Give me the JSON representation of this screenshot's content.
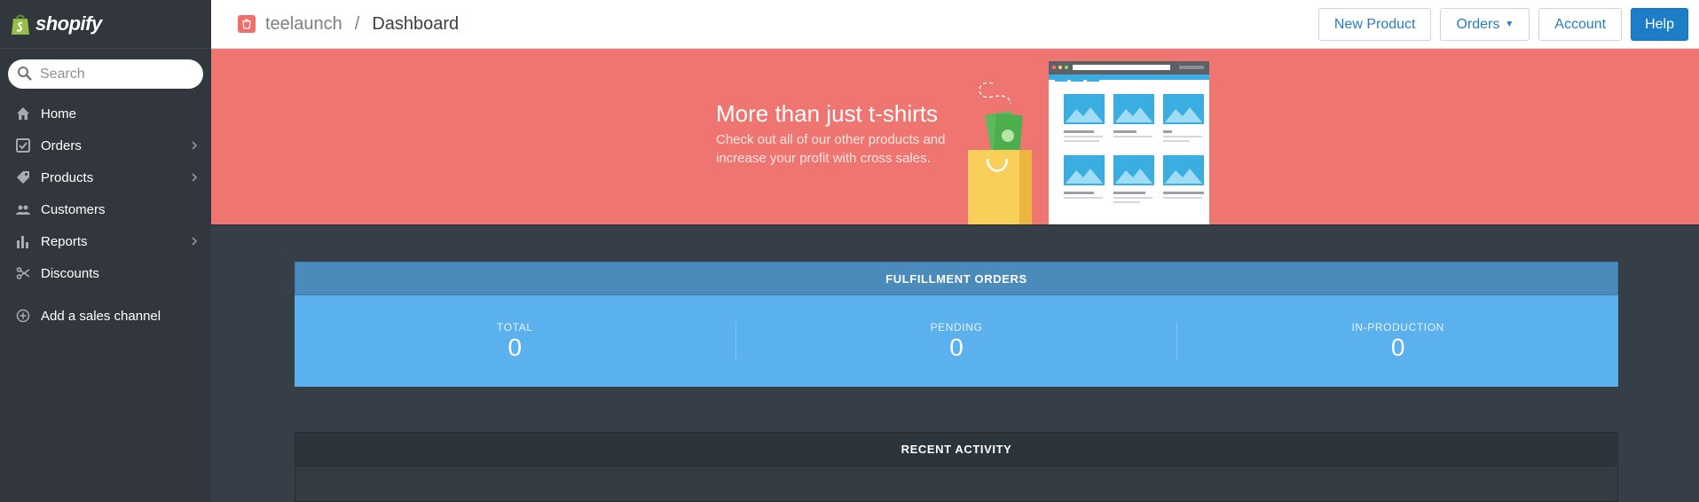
{
  "brand": {
    "name": "shopify"
  },
  "search": {
    "placeholder": "Search"
  },
  "sidebar": {
    "items": [
      {
        "label": "Home",
        "icon": "home-icon",
        "has_submenu": false
      },
      {
        "label": "Orders",
        "icon": "orders-icon",
        "has_submenu": true
      },
      {
        "label": "Products",
        "icon": "tag-icon",
        "has_submenu": true
      },
      {
        "label": "Customers",
        "icon": "customers-icon",
        "has_submenu": false
      },
      {
        "label": "Reports",
        "icon": "bar-chart-icon",
        "has_submenu": true
      },
      {
        "label": "Discounts",
        "icon": "scissors-icon",
        "has_submenu": false
      }
    ],
    "add_channel": {
      "label": "Add a sales channel",
      "icon": "plus-circle-icon"
    }
  },
  "breadcrumb": {
    "store": "teelaunch",
    "separator": "/",
    "current": "Dashboard"
  },
  "toolbar": {
    "new_product": "New Product",
    "orders": "Orders",
    "account": "Account",
    "help": "Help"
  },
  "banner": {
    "title": "More than just t-shirts",
    "subtitle": "Check out all of our other products and increase your profit with cross sales."
  },
  "fulfillment": {
    "title": "FULFILLMENT ORDERS",
    "stats": [
      {
        "label": "TOTAL",
        "value": "0"
      },
      {
        "label": "PENDING",
        "value": "0"
      },
      {
        "label": "IN-PRODUCTION",
        "value": "0"
      }
    ]
  },
  "recent_activity": {
    "title": "RECENT ACTIVITY"
  },
  "colors": {
    "sidebar": "#31373d",
    "banner": "#ef7670",
    "primary": "#1d7dc6",
    "fulfillment_head": "#4a8bbc",
    "fulfillment_body": "#5bb0ee",
    "content_bg": "#363f48"
  }
}
